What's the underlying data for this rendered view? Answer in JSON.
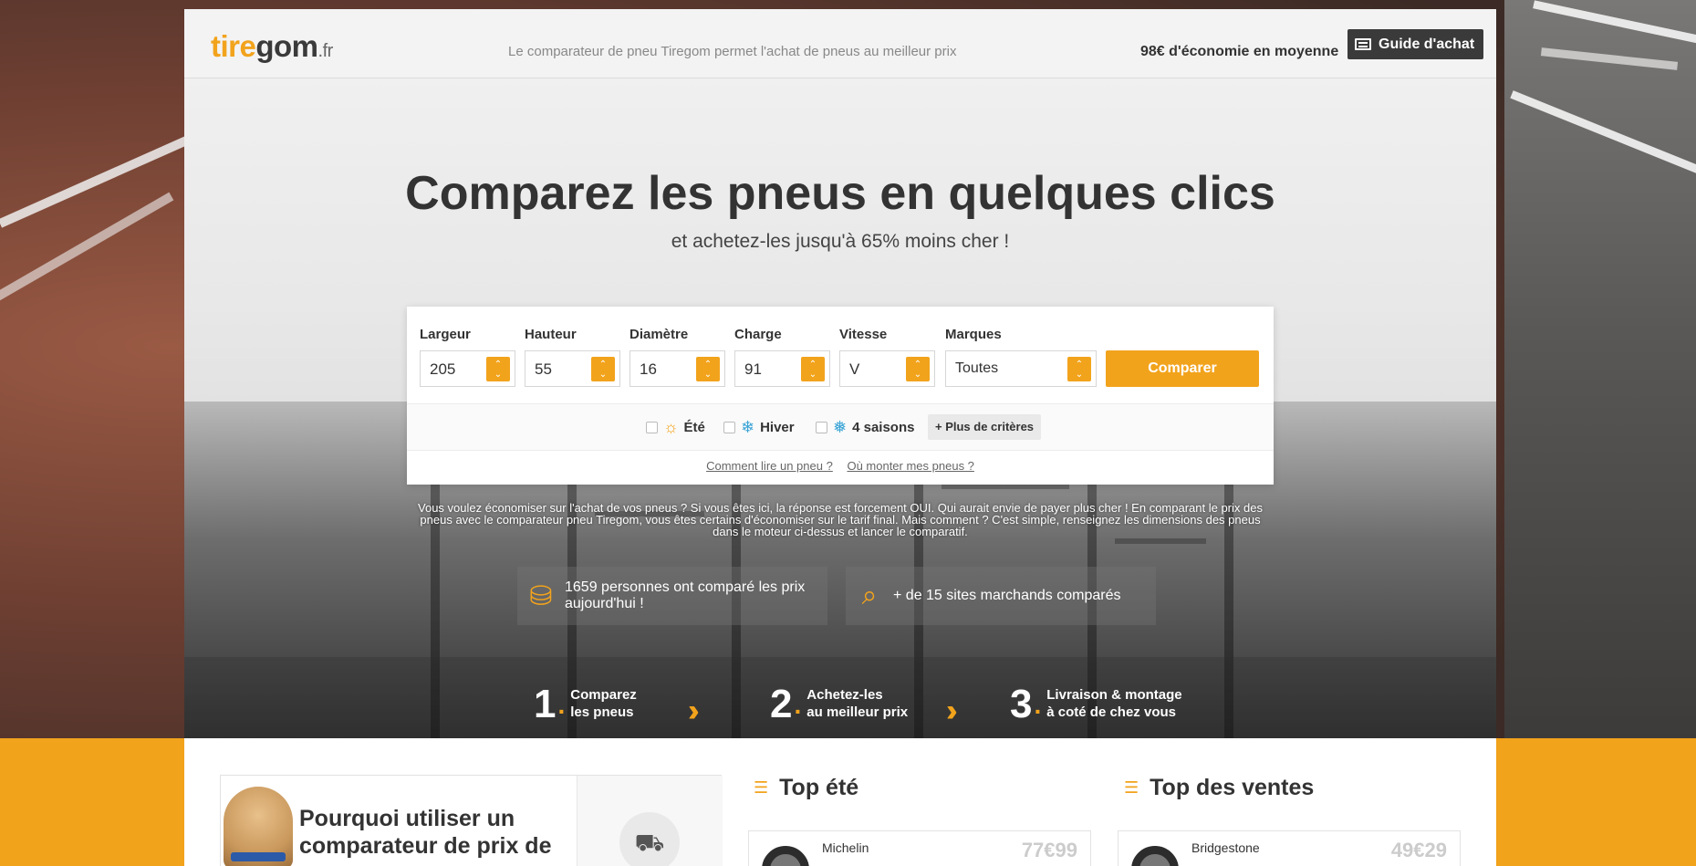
{
  "header": {
    "logo_tire": "tire",
    "logo_gom": "gom",
    "logo_fr": ".fr",
    "tagline": "Le comparateur de pneu Tiregom permet l'achat de pneus au meilleur prix",
    "savings": "98€ d'économie en moyenne",
    "guide_label": "Guide d'achat"
  },
  "hero": {
    "title": "Comparez les pneus en quelques clics",
    "subtitle": "et achetez-les jusqu'à 65% moins cher !"
  },
  "search": {
    "fields": [
      {
        "label": "Largeur",
        "value": "205"
      },
      {
        "label": "Hauteur",
        "value": "55"
      },
      {
        "label": "Diamètre",
        "value": "16"
      },
      {
        "label": "Charge",
        "value": "91"
      },
      {
        "label": "Vitesse",
        "value": "V"
      },
      {
        "label": "Marques",
        "value": "Toutes"
      }
    ],
    "compare_label": "Comparer",
    "seasons": [
      {
        "label": "Été",
        "icon": "sun-icon"
      },
      {
        "label": "Hiver",
        "icon": "snowflake-icon"
      },
      {
        "label": "4 saisons",
        "icon": "all-season-icon"
      }
    ],
    "more_label": "+ Plus de critères",
    "links": [
      "Comment lire un pneu ?",
      "Où monter mes pneus ?"
    ]
  },
  "intro": "Vous voulez économiser sur l'achat de vos pneus ? Si vous êtes ici, la réponse est forcement OUI. Qui aurait envie de payer plus cher ! En comparant le prix des pneus avec le comparateur pneu Tiregom, vous êtes certains d'économiser sur le tarif final. Mais comment ? C'est simple, renseignez les dimensions des pneus dans le moteur ci-dessus et lancer le comparatif.",
  "stats": [
    {
      "icon": "coins-icon",
      "text": "1659 personnes ont comparé les prix aujourd'hui !"
    },
    {
      "icon": "search-compare-icon",
      "text": "+ de 15 sites marchands comparés"
    }
  ],
  "steps": [
    {
      "num": "1",
      "line1": "Comparez",
      "line2": "les pneus"
    },
    {
      "num": "2",
      "line1": "Achetez-les",
      "line2": "au meilleur prix"
    },
    {
      "num": "3",
      "line1": "Livraison & montage",
      "line2": "à coté de chez vous"
    }
  ],
  "bottom": {
    "why_title": "Pourquoi utiliser un comparateur de prix de",
    "top_ete": "Top été",
    "top_ventes": "Top des ventes",
    "products": [
      {
        "brand": "Michelin",
        "price": "77€99"
      },
      {
        "brand": "Bridgestone",
        "price": "49€29"
      }
    ]
  },
  "colors": {
    "accent": "#f2a31c",
    "dark": "#3a3a3a"
  }
}
